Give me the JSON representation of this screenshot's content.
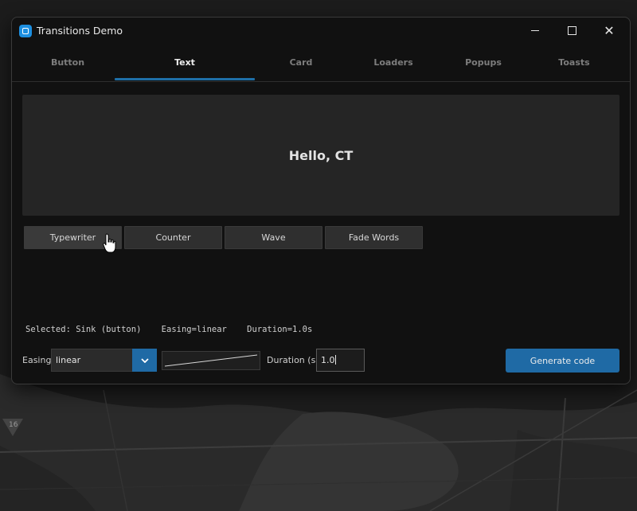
{
  "window": {
    "title": "Transitions Demo",
    "icon": "app-icon"
  },
  "tabs": [
    {
      "label": "Button",
      "active": false
    },
    {
      "label": "Text",
      "active": true
    },
    {
      "label": "Card",
      "active": false
    },
    {
      "label": "Loaders",
      "active": false
    },
    {
      "label": "Popups",
      "active": false
    },
    {
      "label": "Toasts",
      "active": false
    }
  ],
  "preview": {
    "text": "Hello, CT"
  },
  "effects": [
    {
      "label": "Typewriter"
    },
    {
      "label": "Counter"
    },
    {
      "label": "Wave"
    },
    {
      "label": "Fade Words"
    }
  ],
  "status": {
    "text": "Selected: Sink (button)    Easing=linear    Duration=1.0s"
  },
  "controls": {
    "easing_label": "Easing:",
    "easing_value": "linear",
    "duration_label": "Duration (s):",
    "duration_value": "1.0",
    "generate_label": "Generate code"
  },
  "map": {
    "badge_text": "16"
  },
  "colors": {
    "accent": "#1f6aa5",
    "tab_indicator": "#1e6fa8",
    "window_bg": "#111111",
    "preview_bg": "#252525"
  }
}
